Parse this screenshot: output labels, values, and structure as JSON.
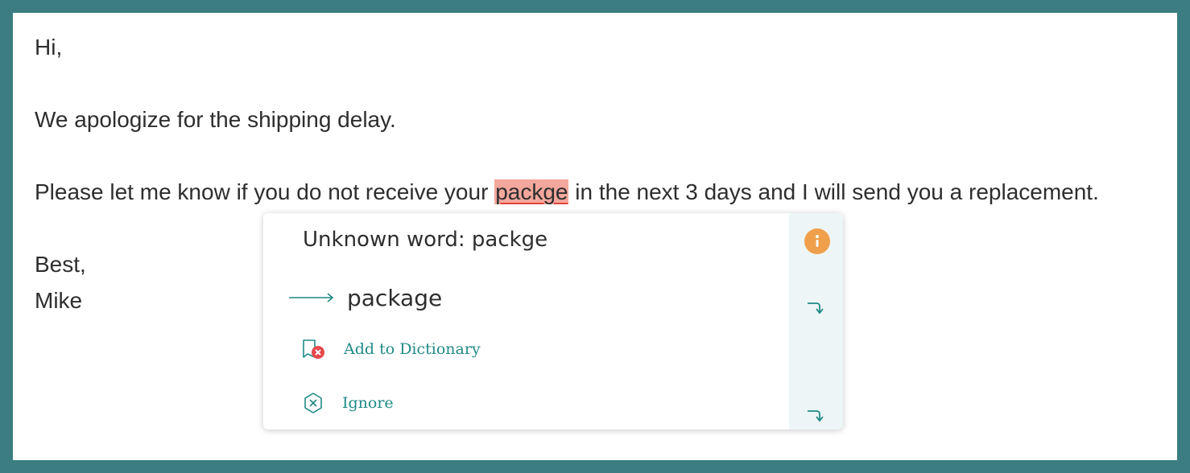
{
  "email": {
    "greeting": "Hi,",
    "line1": "We apologize for the shipping delay.",
    "line2_before": "Please let me know if you do not receive your ",
    "line2_error": "packge",
    "line2_after": " in the next 3 days and I will send you a replacement.",
    "signoff": "Best,",
    "signature": "Mike"
  },
  "popup": {
    "title": "Unknown word: packge",
    "suggestion": "package",
    "add_to_dictionary": "Add to Dictionary",
    "ignore": "Ignore",
    "icons": {
      "info": "info-icon",
      "suggestion_arrow": "long-arrow-right-icon",
      "add_dictionary": "dictionary-remove-icon",
      "ignore": "circle-x-icon",
      "apply": "return-arrow-icon"
    }
  },
  "colors": {
    "frame": "#3b7d80",
    "highlight": "#f4a79c",
    "underline": "#e0443a",
    "accent": "#1f8a86",
    "info": "#f0a04b",
    "sidebar": "#eef5f6"
  }
}
